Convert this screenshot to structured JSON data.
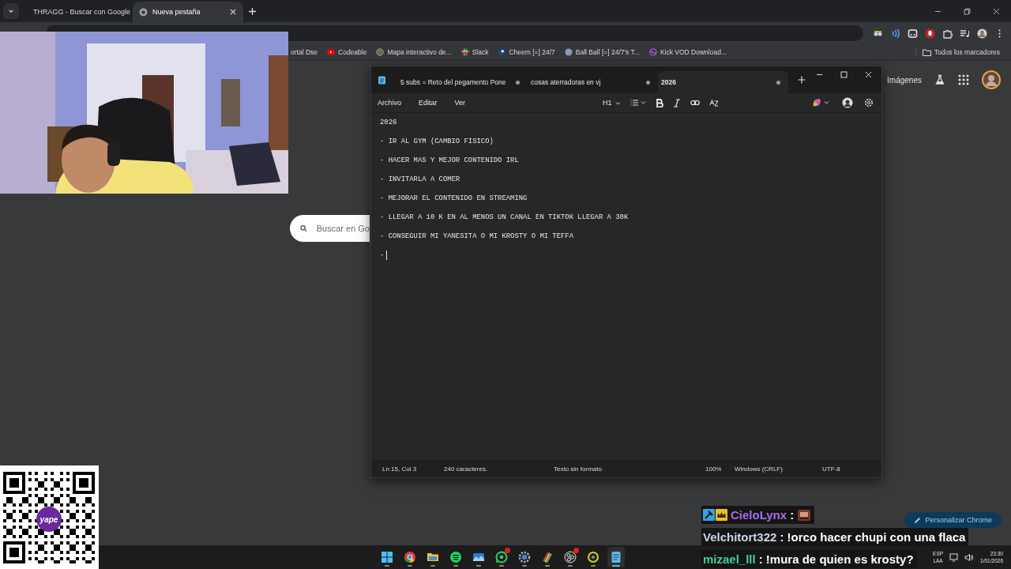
{
  "browser": {
    "tabs": [
      {
        "title": "THRAGG - Buscar con Google",
        "kind": "google",
        "selected": false
      },
      {
        "title": "Nueva pestaña",
        "kind": "chrome",
        "selected": true
      }
    ],
    "bookmarks": [
      {
        "label": "ortal Dse",
        "kind": "plain"
      },
      {
        "label": "Codeable",
        "kind": "video"
      },
      {
        "label": "Mapa interactivo de...",
        "kind": "globe"
      },
      {
        "label": "Slack",
        "kind": "slack"
      },
      {
        "label": "Cheem [=] 24/7",
        "kind": "steam"
      },
      {
        "label": "Ball Ball [=] 24/7's T...",
        "kind": "tf"
      },
      {
        "label": "Kick VOD Download...",
        "kind": "wave"
      }
    ],
    "all_bookmarks": "Todos los marcadores",
    "page": {
      "images_link": "Imágenes",
      "search_placeholder": "Buscar en Go",
      "customize_button": "Personalizar Chrome"
    }
  },
  "notepad": {
    "tabs": [
      {
        "title": "5 subs = Reto del pegamento Pone",
        "modified": true,
        "selected": false
      },
      {
        "title": "cosas aterradoras en vj",
        "modified": true,
        "selected": false
      },
      {
        "title": "2026",
        "modified": true,
        "selected": true
      }
    ],
    "menu": [
      "Archivo",
      "Editar",
      "Ver"
    ],
    "heading_button": "H1",
    "lines": [
      "2026",
      "- IR AL GYM (CAMBIO FISICO)",
      "- HACER MAS Y MEJOR CONTENIDO IRL",
      "- INVITARLA A COMER",
      "- MEJORAR EL CONTENIDO EN STREAMING",
      "- LLEGAR A 10 K EN AL MENOS UN CANAL EN TIKTOK LLEGAR A 30K",
      "- CONSEGUIR MI YANESITA O MI KROSTY O MI TEFFA",
      "-"
    ],
    "status": {
      "position": "Ln 15, Col 3",
      "characters": "240 caracteres.",
      "format": "Texto sin formato",
      "zoom": "100%",
      "line_ending": "Windows (CRLF)",
      "encoding": "UTF-8"
    }
  },
  "chat": [
    {
      "user": "CieloLynx",
      "color": "#a66cf0",
      "badges": true,
      "message": ":",
      "emote": true
    },
    {
      "user": "Velchitort322",
      "color": "#c9d6e6",
      "badges": false,
      "message": ": !orco hacer chupi con una flaca",
      "emote": false
    },
    {
      "user": "mizael_lll",
      "color": "#3fcf8e",
      "badges": false,
      "message": ": !mura de quien es krosty?",
      "emote": false
    }
  ],
  "qr": {
    "logo": "yape"
  },
  "taskbar": {
    "items": [
      {
        "kind": "start",
        "selected": false,
        "notified": false
      },
      {
        "kind": "chrome",
        "selected": false,
        "notified": false
      },
      {
        "kind": "folder",
        "selected": false,
        "notified": false
      },
      {
        "kind": "music",
        "selected": false,
        "notified": false
      },
      {
        "kind": "photos",
        "selected": false,
        "notified": false
      },
      {
        "kind": "whatsapp",
        "selected": false,
        "notified": true
      },
      {
        "kind": "settings",
        "selected": false,
        "notified": false
      },
      {
        "kind": "stripes",
        "selected": false,
        "notified": false
      },
      {
        "kind": "obs",
        "selected": false,
        "notified": true
      },
      {
        "kind": "disc",
        "selected": false,
        "notified": false
      },
      {
        "kind": "notepad",
        "selected": true,
        "notified": false
      }
    ],
    "tray": {
      "language": "ESP",
      "layout": "LAA",
      "time": "23:30",
      "date": "1/01/2026"
    }
  }
}
